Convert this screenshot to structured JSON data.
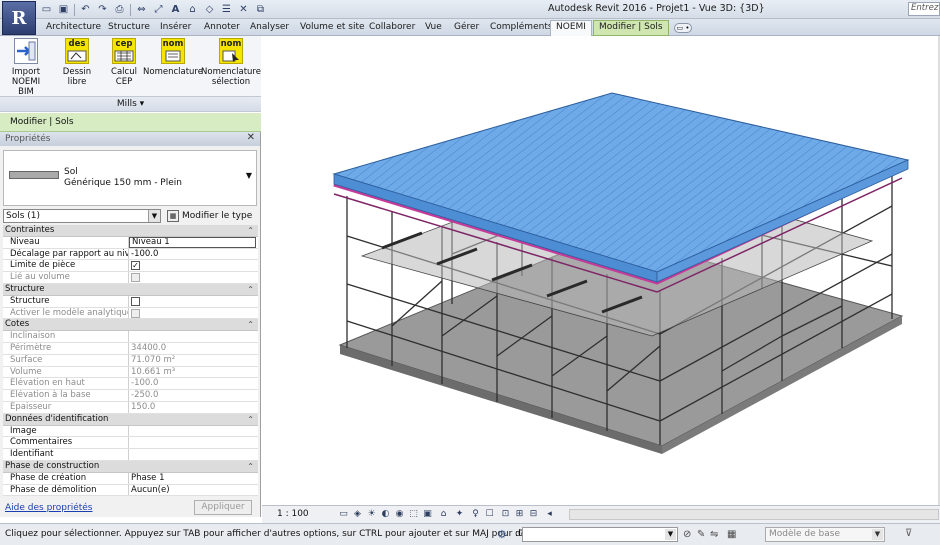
{
  "titlebar": {
    "title": "Autodesk Revit 2016 -   Projet1 - Vue 3D: {3D}",
    "search_placeholder": "Entrez",
    "app_button_icon": "revit-R-icon",
    "qat_icons": [
      "open-icon",
      "save-icon",
      "undo-icon",
      "redo-icon",
      "print-icon",
      "measure-icon",
      "text-A-icon",
      "home-icon",
      "view-icon",
      "close-view-icon",
      "switch-windows-icon"
    ]
  },
  "tabs": {
    "items": [
      "Architecture",
      "Structure",
      "Insérer",
      "Annoter",
      "Analyser",
      "Volume et site",
      "Collaborer",
      "Vue",
      "Gérer",
      "Compléments",
      "NOEMI",
      "Modifier | Sols"
    ],
    "active": "NOEMI",
    "contextual": "Modifier | Sols",
    "extra_label": "▭ •"
  },
  "ribbon": {
    "buttons": [
      {
        "label1": "Import",
        "label2": "NOEMI BIM",
        "icon": "import-arrow-icon"
      },
      {
        "label1": "Dessin libre",
        "label2": "",
        "icon": "des-icon",
        "icon_text": "des"
      },
      {
        "label1": "Calcul CEP",
        "label2": "",
        "icon": "cep-icon",
        "icon_text": "cep"
      },
      {
        "label1": "Nomenclature",
        "label2": "",
        "icon": "nom-icon",
        "icon_text": "nom"
      },
      {
        "label1": "Nomenclature",
        "label2": "sélection",
        "icon": "nom-selection-icon",
        "icon_text": "nom"
      }
    ],
    "panel_label": "Mills ▾"
  },
  "contextbar": {
    "label": "Modifier | Sols"
  },
  "properties": {
    "header": "Propriétés",
    "type_line1": "Sol",
    "type_line2": "Générique 150 mm - Plein",
    "instance_filter": "Sols (1)",
    "edit_type": "Modifier le type",
    "groups": [
      {
        "name": "Contraintes",
        "rows": [
          {
            "k": "Niveau",
            "v": "Niveau 1",
            "boxed": true
          },
          {
            "k": "Décalage par rapport au niv...",
            "v": "-100.0"
          },
          {
            "k": "Limite de pièce",
            "v": "",
            "cb": "checked"
          },
          {
            "k": "Lié au volume",
            "v": "",
            "cb": "disabled",
            "dis": true
          }
        ]
      },
      {
        "name": "Structure",
        "rows": [
          {
            "k": "Structure",
            "v": "",
            "cb": "unchecked"
          },
          {
            "k": "Activer le modèle analytique",
            "v": "",
            "cb": "disabled",
            "dis": true
          }
        ]
      },
      {
        "name": "Cotes",
        "rows": [
          {
            "k": "Inclinaison",
            "v": "",
            "dis": true
          },
          {
            "k": "Périmètre",
            "v": "34400.0",
            "dis": true
          },
          {
            "k": "Surface",
            "v": "71.070 m²",
            "dis": true
          },
          {
            "k": "Volume",
            "v": "10.661 m³",
            "dis": true
          },
          {
            "k": "Élévation en haut",
            "v": "-100.0",
            "dis": true
          },
          {
            "k": "Élévation à la base",
            "v": "-250.0",
            "dis": true
          },
          {
            "k": "Epaisseur",
            "v": "150.0",
            "dis": true
          }
        ]
      },
      {
        "name": "Données d'identification",
        "rows": [
          {
            "k": "Image",
            "v": ""
          },
          {
            "k": "Commentaires",
            "v": ""
          },
          {
            "k": "Identifiant",
            "v": ""
          }
        ]
      },
      {
        "name": "Phase de construction",
        "rows": [
          {
            "k": "Phase de création",
            "v": "Phase 1"
          },
          {
            "k": "Phase de démolition",
            "v": "Aucun(e)"
          }
        ]
      }
    ],
    "help_link": "Aide des propriétés",
    "apply": "Appliquer"
  },
  "viewbar": {
    "scale": "1 : 100"
  },
  "statusbar": {
    "text": "Cliquez pour sélectionner. Appuyez sur TAB pour afficher d'autres options, sur CTRL pour ajouter et sur MAJ pour désactiver.",
    "selection_count": ":0",
    "model_dropdown": "Modèle de base"
  },
  "colors": {
    "roof": "#6aa6e6",
    "beam_magenta": "#c43b9a",
    "slab": "#8f8f8f",
    "scaffold": "#3a3a3a",
    "context_green": "#d7ecc3"
  }
}
